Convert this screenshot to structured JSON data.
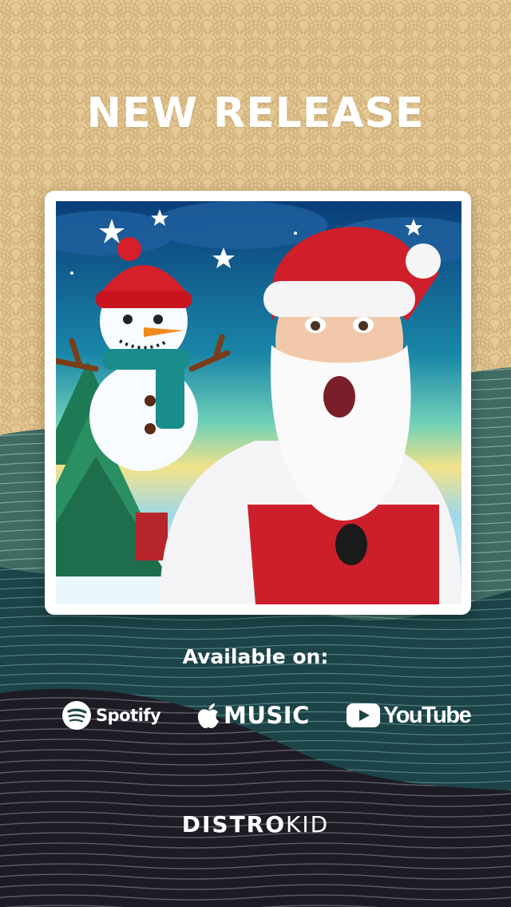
{
  "headline": "NEW RELEASE",
  "available_label": "Available on:",
  "services": [
    {
      "name": "Spotify",
      "icon": "spotify-icon"
    },
    {
      "name": "MUSIC",
      "icon": "apple-icon"
    },
    {
      "name": "YouTube",
      "icon": "youtube-play-icon"
    }
  ],
  "footer": {
    "brand_bold": "DISTRO",
    "brand_light": "KID"
  },
  "colors": {
    "sand_background": "#e3c895",
    "wave_green": "#3f6b62",
    "wave_dark_teal": "#1c4448",
    "bottom_dark": "#1d1c24",
    "text": "#ffffff",
    "youtube_red": "#ffffff"
  }
}
